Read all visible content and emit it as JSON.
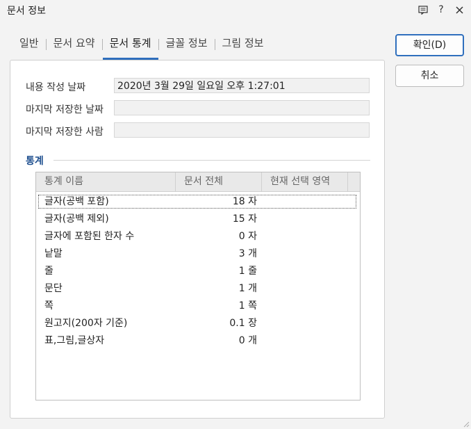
{
  "window": {
    "title": "문서 정보"
  },
  "tabs": [
    {
      "label": "일반"
    },
    {
      "label": "문서 요약"
    },
    {
      "label": "문서 통계"
    },
    {
      "label": "글꼴 정보"
    },
    {
      "label": "그림 정보"
    }
  ],
  "fields": {
    "created_label": "내용 작성 날짜",
    "created_value": "2020년 3월 29일 일요일 오후 1:27:01",
    "saved_date_label": "마지막 저장한 날짜",
    "saved_date_value": "",
    "saved_by_label": "마지막 저장한 사람",
    "saved_by_value": ""
  },
  "stats": {
    "section_title": "통계",
    "columns": [
      "통계 이름",
      "문서 전체",
      "현재 선택 영역"
    ],
    "rows": [
      {
        "name": "글자(공백 포함)",
        "total": "18 자",
        "selection": ""
      },
      {
        "name": "글자(공백 제외)",
        "total": "15 자",
        "selection": ""
      },
      {
        "name": "글자에 포함된 한자 수",
        "total": "0 자",
        "selection": ""
      },
      {
        "name": "낱말",
        "total": "3 개",
        "selection": ""
      },
      {
        "name": "줄",
        "total": "1 줄",
        "selection": ""
      },
      {
        "name": "문단",
        "total": "1 개",
        "selection": ""
      },
      {
        "name": "쪽",
        "total": "1 쪽",
        "selection": ""
      },
      {
        "name": "원고지(200자 기준)",
        "total": "0.1 장",
        "selection": ""
      },
      {
        "name": "표,그림,글상자",
        "total": "0 개",
        "selection": ""
      }
    ]
  },
  "buttons": {
    "ok": "확인(D)",
    "cancel": "취소"
  },
  "colors": {
    "accent": "#2f6fbd",
    "section": "#1e4f8f"
  },
  "icons": [
    "comment-icon",
    "help-icon",
    "close-icon"
  ]
}
